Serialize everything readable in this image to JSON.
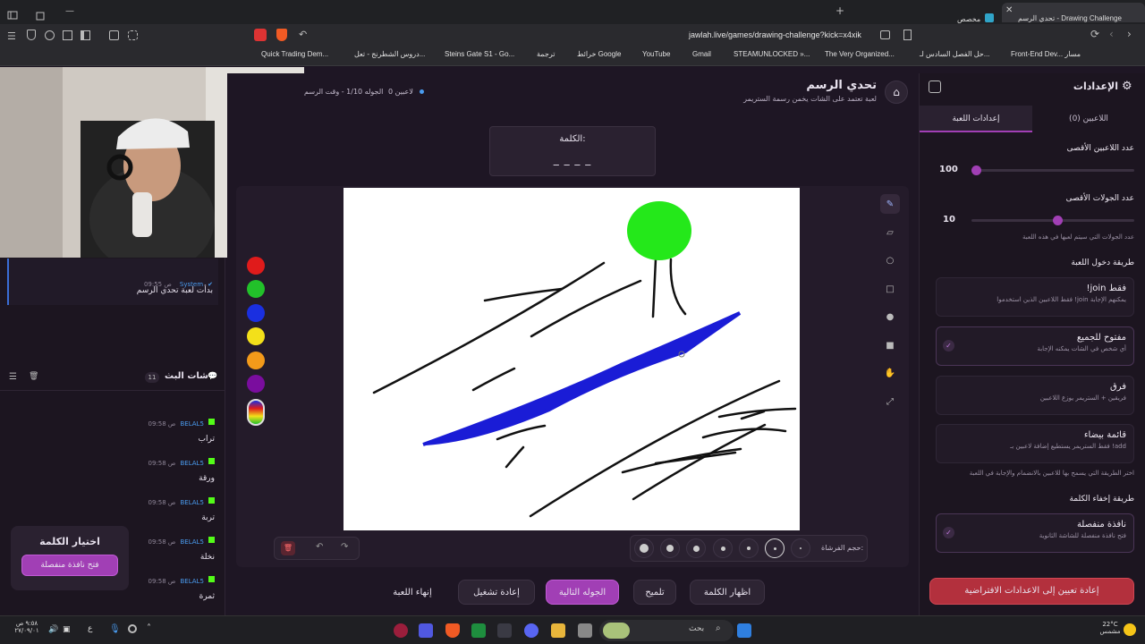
{
  "browser": {
    "tabs": [
      {
        "label": "تحدي الرسم - Drawing Challenge",
        "active": true
      },
      {
        "label": "مخصص",
        "active": false
      }
    ],
    "url": "jawlah.live/games/drawing-challenge?kick=x4xik",
    "bookmarks": [
      "Front-End Dev... مسار",
      "حل الفصل السادس لـ...",
      "The Very Organized...",
      "STEAMUNLOCKED »...",
      "Gmail",
      "YouTube",
      "خرائط Google",
      "ترجمة",
      "Steins Gate S1 - Go...",
      "دروس الشطرنج - تعل...",
      "Quick Trading Dem..."
    ]
  },
  "header": {
    "title": "تحدي الرسم",
    "subtitle": "لعبة تعتمد على الشات يخمن رسمة الستريمر",
    "round_info": "الجوله 1/10 - وقت الرسم",
    "players": "0 لاعبين"
  },
  "word_box": {
    "label": "الكلمة:",
    "mask": "_ _ _ _"
  },
  "colors": {
    "palette": [
      "#e01b1b",
      "#22c12a",
      "#1a2fe0",
      "#f3e01a",
      "#f39a1a",
      "#7a0d9e"
    ],
    "accent": "#a13fb5",
    "bg": "#1e1624"
  },
  "tools": [
    "pencil-icon",
    "eraser-icon",
    "circle-icon",
    "square-icon",
    "fill-circle-icon",
    "fill-square-icon",
    "hand-icon",
    "line-icon"
  ],
  "brush": {
    "label": "حجم الفرشاة:"
  },
  "actions": {
    "end_game": "إنهاء اللعبة",
    "restart": "إعادة تشغيل",
    "next_round": "الجوله التالية",
    "hint": "تلميح",
    "reveal_word": "اظهار الكلمة"
  },
  "settings": {
    "title": "الإعدادات",
    "tab_game": "إعدادات اللعبة",
    "tab_players": "اللاعبين (0)",
    "max_players_label": "عدد اللاعبين الأقصى",
    "max_players": 100,
    "max_players_level": 0.03,
    "max_rounds_label": "عدد الجولات الأقصى",
    "max_rounds": 10,
    "max_rounds_level": 0.53,
    "rounds_hint": "عدد الجولات التي سيتم لعبها في هذه اللعبة",
    "join_label": "طريقة دخول اللعبة",
    "join_options": [
      {
        "title": "!join فقط",
        "desc": "فقط اللاعبين الذين استخدموا !join يمكنهم الإجابة",
        "selected": false
      },
      {
        "title": "مفتوح للجميع",
        "desc": "أي شخص في الشات يمكنه الإجابة",
        "selected": true
      },
      {
        "title": "فرق",
        "desc": "فريقين + الستريمر يوزع اللاعبين",
        "selected": false
      },
      {
        "title": "قائمة بيضاء",
        "desc": "فقط الستريمر يستطيع إضافة لاعبين بـ !add",
        "selected": false
      }
    ],
    "join_hint": "اختر الطريقة التي يسمح بها للاعبين بالانضمام والإجابة في اللعبة",
    "hide_label": "طريقة إخفاء الكلمة",
    "hide_option": {
      "title": "نافذة منفصلة",
      "desc": "فتح نافذة منفصلة للشاشة الثانوية"
    },
    "reset": "إعادة تعيين إلى الاعدادات الافتراضية"
  },
  "chat": {
    "system_name": "System",
    "system_time": "09:55 ص",
    "system_msg": "بدأت لعبة تحدي الرسم",
    "title": "شات البث",
    "count": "11",
    "messages": [
      {
        "user": "BELAL5",
        "time": "09:58 ص",
        "text": "تراب"
      },
      {
        "user": "BELAL5",
        "time": "09:58 ص",
        "text": "ورقة"
      },
      {
        "user": "BELAL5",
        "time": "09:58 ص",
        "text": "تربة"
      },
      {
        "user": "BELAL5",
        "time": "09:58 ص",
        "text": "نخلة"
      },
      {
        "user": "BELAL5",
        "time": "09:58 ص",
        "text": "ثمرة"
      }
    ]
  },
  "word_picker": {
    "title": "اختيار الكلمة",
    "button": "فتح نافذة منفصلة"
  },
  "taskbar": {
    "search": "بحث",
    "weather": "22°C",
    "weather_desc": "مشمس",
    "time": "٩:٥٨ ص",
    "date": "٢٧/٠٩/٠١",
    "lang": "ع"
  }
}
